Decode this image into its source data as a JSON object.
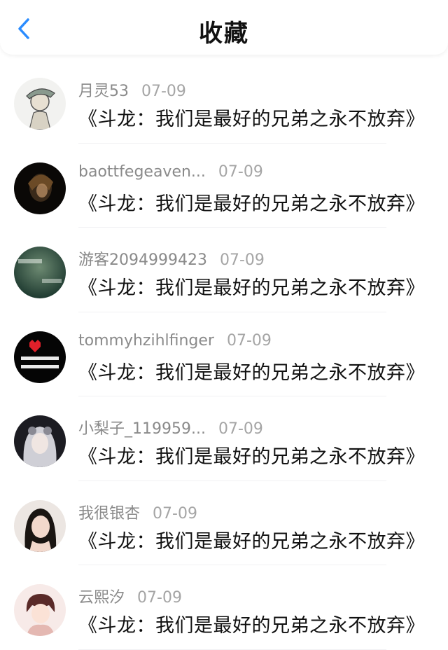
{
  "header": {
    "title": "收藏",
    "back_icon": "chevron-left-icon",
    "accent": "#2a8cff"
  },
  "items": [
    {
      "user": "月灵53",
      "date": "07-09",
      "text": "《斗龙：我们是最好的兄弟之永不放弃》"
    },
    {
      "user": "baottfegeaven...",
      "date": "07-09",
      "text": "《斗龙：我们是最好的兄弟之永不放弃》"
    },
    {
      "user": "游客2094999423",
      "date": "07-09",
      "text": "《斗龙：我们是最好的兄弟之永不放弃》"
    },
    {
      "user": "tommyhzihlfinger",
      "date": "07-09",
      "text": "《斗龙：我们是最好的兄弟之永不放弃》"
    },
    {
      "user": "小梨子_119959...",
      "date": "07-09",
      "text": "《斗龙：我们是最好的兄弟之永不放弃》"
    },
    {
      "user": "我很银杏",
      "date": "07-09",
      "text": "《斗龙：我们是最好的兄弟之永不放弃》"
    },
    {
      "user": "云熙汐",
      "date": "07-09",
      "text": "《斗龙：我们是最好的兄弟之永不放弃》"
    }
  ]
}
